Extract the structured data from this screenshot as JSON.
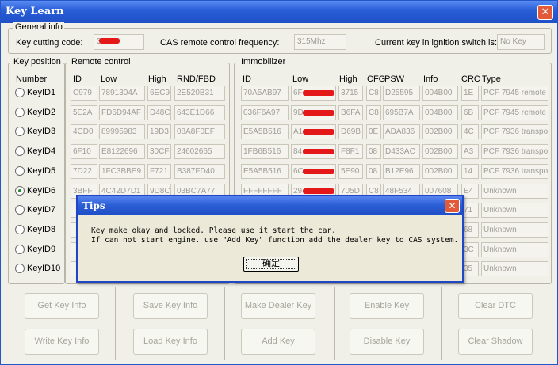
{
  "window": {
    "title": "Key Learn",
    "close_glyph": "✕"
  },
  "general": {
    "title": "General info",
    "cutting_label": "Key cutting code:",
    "cutting_value": "3",
    "cas_label": "CAS remote control frequency:",
    "cas_value": "315Mhz",
    "ignition_label": "Current key in ignition switch is:",
    "ignition_value": "No Key"
  },
  "keypos": {
    "title": "Key position",
    "header": "Number",
    "keys": [
      "KeyID1",
      "KeyID2",
      "KeyID3",
      "KeyID4",
      "KeyID5",
      "KeyID6",
      "KeyID7",
      "KeyID8",
      "KeyID9",
      "KeyID10"
    ],
    "selected": "KeyID6"
  },
  "remote": {
    "title": "Remote control",
    "headers": {
      "id": "ID",
      "low": "Low",
      "high": "High",
      "rnd": "RND/FBD"
    },
    "rows": [
      [
        "C979",
        "7891304A",
        "6EC9",
        "2E520B31"
      ],
      [
        "5E2A",
        "FD6D94AF",
        "D48C",
        "643E1D66"
      ],
      [
        "4CD0",
        "89995983",
        "19D3",
        "08A8F0EF"
      ],
      [
        "6F10",
        "E8122696",
        "30CF",
        "24602665"
      ],
      [
        "7D22",
        "1FC3BBE9",
        "F721",
        "B387FD40"
      ],
      [
        "3BFF",
        "4C42D7D1",
        "9D8C",
        "03BC7A77"
      ],
      [
        "",
        "",
        "",
        ""
      ],
      [
        "",
        "",
        "",
        ""
      ],
      [
        "",
        "",
        "",
        ""
      ],
      [
        "",
        "",
        "",
        ""
      ]
    ]
  },
  "immo": {
    "title": "Immobilizer",
    "headers": {
      "id": "ID",
      "low": "Low",
      "high": "High",
      "cfg": "CFG",
      "psw": "PSW",
      "info": "Info",
      "crc": "CRC",
      "type": "Type"
    },
    "rows": [
      [
        "70A5AB97",
        "6F",
        "3715",
        "C8",
        "D25595",
        "004B00",
        "1E",
        "PCF 7945 remote"
      ],
      [
        "036F6A97",
        "9D",
        "B6FA",
        "C8",
        "695B7A",
        "004B00",
        "6B",
        "PCF 7945 remote"
      ],
      [
        "E5A5B516",
        "A1",
        "D69B",
        "0E",
        "ADA836",
        "002B00",
        "4C",
        "PCF 7936 transpo"
      ],
      [
        "1FB6B516",
        "84",
        "F8F1",
        "08",
        "D433AC",
        "002B00",
        "A3",
        "PCF 7936 transpo"
      ],
      [
        "E5A5B516",
        "6C",
        "5E90",
        "08",
        "B12E96",
        "002B00",
        "14",
        "PCF 7936 transpo"
      ],
      [
        "FFFFFFFF",
        "29",
        "705D",
        "C8",
        "48F534",
        "007608",
        "E4",
        "Unknown"
      ],
      [
        "",
        "",
        "",
        "",
        "",
        "",
        "71",
        "Unknown"
      ],
      [
        "",
        "",
        "",
        "",
        "",
        "",
        "68",
        "Unknown"
      ],
      [
        "",
        "",
        "",
        "",
        "",
        "",
        "3C",
        "Unknown"
      ],
      [
        "",
        "",
        "",
        "",
        "",
        "",
        "35",
        "Unknown"
      ]
    ]
  },
  "buttons": {
    "get_key_info": "Get Key Info",
    "write_key_info": "Write Key Info",
    "save_key_info": "Save Key Info",
    "load_key_info": "Load Key Info",
    "make_dealer_key": "Make Dealer Key",
    "add_key": "Add Key",
    "enable_key": "Enable Key",
    "disable_key": "Disable Key",
    "clear_dtc": "Clear DTC",
    "clear_shadow": "Clear Shadow"
  },
  "dialog": {
    "title": "Tips",
    "line1": "Key make okay and locked. Please use it start the car.",
    "line2": "If can not start engine. use \"Add Key\" function add the dealer key to CAS system.",
    "ok": "确定",
    "close_glyph": "✕"
  },
  "colors": {
    "titlebar": "#2a5fd8",
    "redaction": "#e41818",
    "dialog_border": "#1f46c4"
  }
}
